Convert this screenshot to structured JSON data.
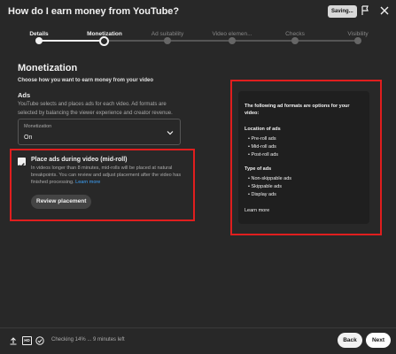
{
  "window": {
    "title": "How do I earn money from YouTube?",
    "saving_label": "Saving..."
  },
  "stepper": {
    "steps": [
      {
        "label": "Details",
        "state": "done"
      },
      {
        "label": "Monetization",
        "state": "current"
      },
      {
        "label": "Ad suitability",
        "state": "upcoming"
      },
      {
        "label": "Video elemen...",
        "state": "upcoming"
      },
      {
        "label": "Checks",
        "state": "upcoming"
      },
      {
        "label": "Visibility",
        "state": "upcoming"
      }
    ]
  },
  "monetization": {
    "title": "Monetization",
    "subtitle": "Choose how you want to earn money from your video",
    "ads_title": "Ads",
    "ads_description": "YouTube selects and places ads for each video. Ad formats are selected by balancing the viewer experience and creator revenue.",
    "dropdown_label": "Monetization",
    "dropdown_value": "On"
  },
  "midroll": {
    "checked": true,
    "title": "Place ads during video (mid-roll)",
    "description": "In videos longer than 8 minutes, mid-rolls will be placed at natural breakpoints. You can review and adjust placement after the video has finished processing.",
    "learn_more": "Learn more",
    "review_button": "Review placement"
  },
  "info": {
    "intro": "The following ad formats are options for your video:",
    "location_title": "Location of ads",
    "locations": [
      "Pre-roll ads",
      "Mid-roll ads",
      "Post-roll ads"
    ],
    "type_title": "Type of ads",
    "types": [
      "Non-skippable ads",
      "Skippable ads",
      "Display ads"
    ],
    "learn_more": "Learn more"
  },
  "footer": {
    "hd_label": "HD",
    "status": "Checking 14% ... 9 minutes left",
    "back_label": "Back",
    "next_label": "Next"
  },
  "colors": {
    "accent": "#e01e1e",
    "link": "#3ea6ff",
    "background": "#282828"
  }
}
